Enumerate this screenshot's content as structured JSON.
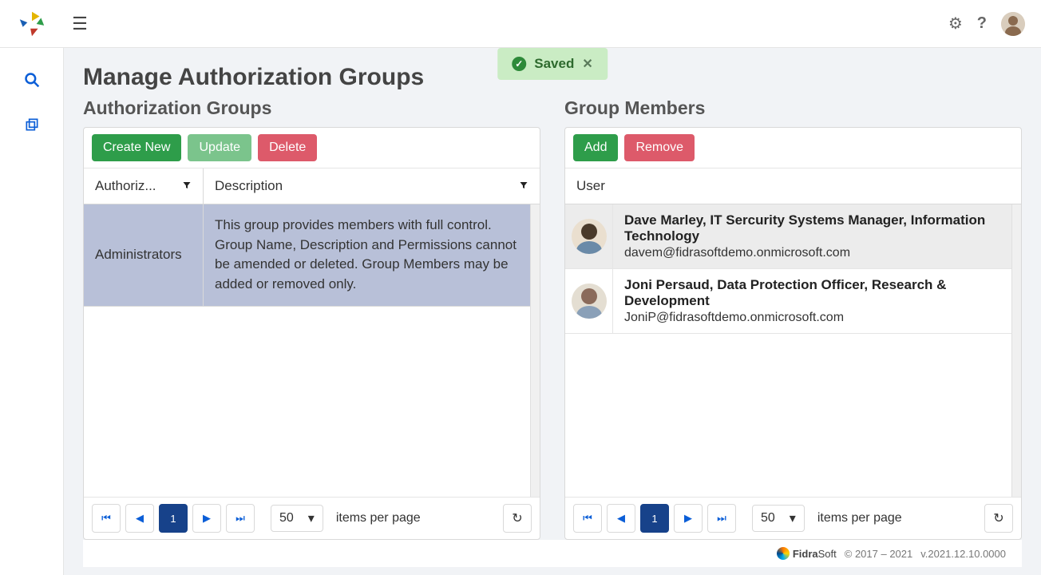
{
  "toast": {
    "label": "Saved"
  },
  "page": {
    "title": "Manage Authorization Groups"
  },
  "groups": {
    "title": "Authorization Groups",
    "buttons": {
      "create": "Create New",
      "update": "Update",
      "delete": "Delete"
    },
    "columns": {
      "auth": "Authoriz...",
      "desc": "Description"
    },
    "rows": [
      {
        "name": "Administrators",
        "desc": "This group provides members with full control. Group Name, Description and Permissions cannot be amended or deleted. Group Members may be added or removed only."
      }
    ],
    "pager": {
      "page": "1",
      "size": "50",
      "label": "items per page"
    }
  },
  "members": {
    "title": "Group Members",
    "buttons": {
      "add": "Add",
      "remove": "Remove"
    },
    "columns": {
      "user": "User"
    },
    "rows": [
      {
        "name": "Dave Marley, IT Sercurity Systems Manager, Information Technology",
        "email": "davem@fidrasoftdemo.onmicrosoft.com"
      },
      {
        "name": "Joni Persaud, Data Protection Officer, Research & Development",
        "email": "JoniP@fidrasoftdemo.onmicrosoft.com"
      }
    ],
    "pager": {
      "page": "1",
      "size": "50",
      "label": "items per page"
    }
  },
  "footer": {
    "brand_left": "Fidra",
    "brand_right": "Soft",
    "copyright": "© 2017 – 2021",
    "version": "v.2021.12.10.0000"
  }
}
